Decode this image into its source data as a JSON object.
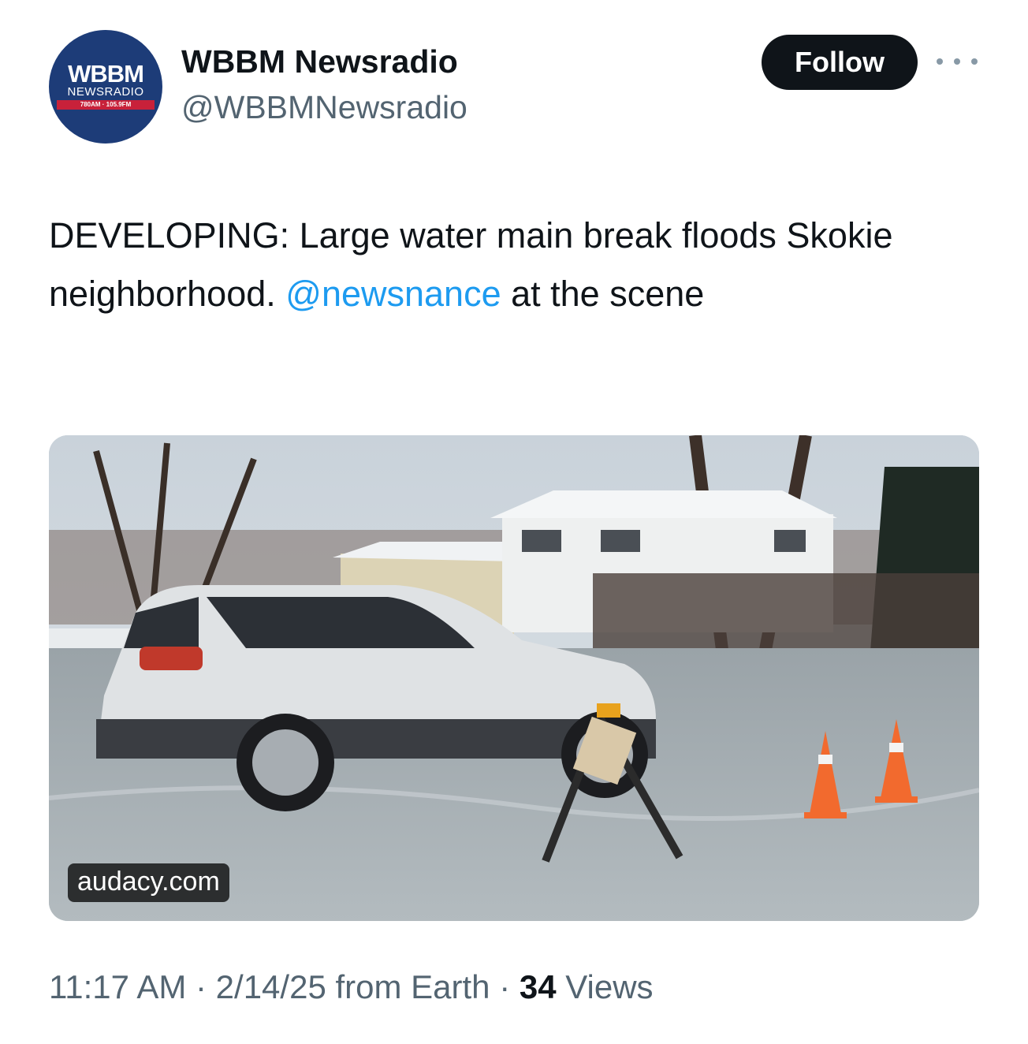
{
  "account": {
    "display_name": "WBBM Newsradio",
    "handle": "@WBBMNewsradio",
    "avatar": {
      "logo_main": "WBBM",
      "logo_sub": "NEWSRADIO",
      "logo_freq": "780AM · 105.9FM",
      "background_color": "#1d3c78",
      "accent_color": "#c8213a"
    }
  },
  "actions": {
    "follow_label": "Follow",
    "more_icon": "more-horizontal-icon"
  },
  "tweet": {
    "text_before": "DEVELOPING: Large water main break floods Skokie neighborhood. ",
    "mention": "@newsnance",
    "text_after": " at the scene"
  },
  "media": {
    "source_label": "audacy.com"
  },
  "meta": {
    "time": "11:17 AM",
    "sep1": " · ",
    "date_source": "2/14/25 from Earth",
    "sep2": " · ",
    "views_count": "34",
    "views_label": " Views"
  },
  "colors": {
    "link": "#1d9bf0",
    "secondary_text": "#536471",
    "primary_text": "#0f1419"
  }
}
